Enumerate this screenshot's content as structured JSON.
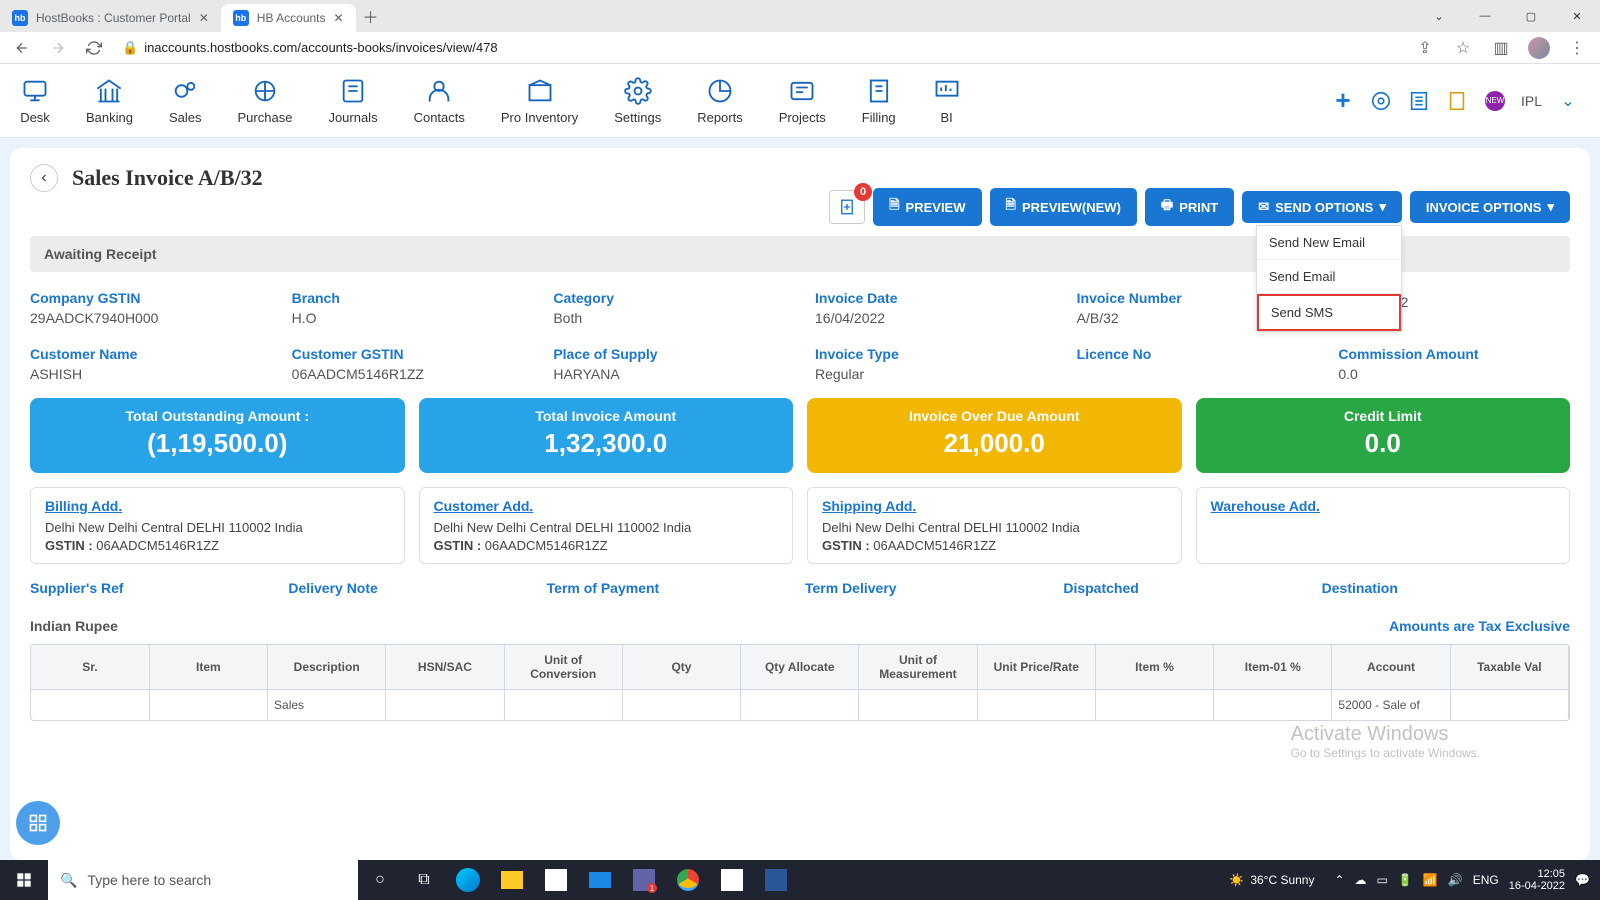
{
  "browser": {
    "tabs": [
      {
        "title": "HostBooks : Customer Portal",
        "favicon": "hb",
        "active": false
      },
      {
        "title": "HB Accounts",
        "favicon": "hb",
        "active": true
      }
    ],
    "url": "inaccounts.hostbooks.com/accounts-books/invoices/view/478"
  },
  "appnav": {
    "items": [
      "Desk",
      "Banking",
      "Sales",
      "Purchase",
      "Journals",
      "Contacts",
      "Pro Inventory",
      "Settings",
      "Reports",
      "Projects",
      "Filling",
      "BI"
    ],
    "company": "IPL"
  },
  "page_title": "Sales Invoice A/B/32",
  "buttons": {
    "preview": "PREVIEW",
    "preview_new": "PREVIEW(NEW)",
    "print": "PRINT",
    "send": "SEND OPTIONS",
    "invoice": "INVOICE OPTIONS",
    "badge": "0"
  },
  "send_menu": [
    "Send New Email",
    "Send Email",
    "Send SMS"
  ],
  "status": "Awaiting Receipt",
  "info": [
    {
      "l": "Company GSTIN",
      "v": "29AADCK7940H000"
    },
    {
      "l": "Branch",
      "v": "H.O"
    },
    {
      "l": "Category",
      "v": "Both"
    },
    {
      "l": "Invoice Date",
      "v": "16/04/2022"
    },
    {
      "l": "Invoice Number",
      "v": "A/B/32"
    },
    {
      "l": "",
      "v": "26/04/2022"
    },
    {
      "l": "Customer Name",
      "v": "ASHISH"
    },
    {
      "l": "Customer GSTIN",
      "v": "06AADCM5146R1ZZ"
    },
    {
      "l": "Place of Supply",
      "v": "HARYANA"
    },
    {
      "l": "Invoice Type",
      "v": "Regular"
    },
    {
      "l": "Licence No",
      "v": ""
    },
    {
      "l": "Commission Amount",
      "v": "0.0"
    }
  ],
  "summary": [
    {
      "t": "Total Outstanding Amount :",
      "v": "(1,19,500.0)",
      "c": "sb-blue"
    },
    {
      "t": "Total Invoice Amount",
      "v": "1,32,300.0",
      "c": "sb-blue"
    },
    {
      "t": "Invoice Over Due Amount",
      "v": "21,000.0",
      "c": "sb-yellow"
    },
    {
      "t": "Credit Limit",
      "v": "0.0",
      "c": "sb-green"
    }
  ],
  "addresses": [
    {
      "h": "Billing Add.",
      "ln": "Delhi New Delhi Central DELHI 110002 India",
      "g": "06AADCM5146R1ZZ"
    },
    {
      "h": "Customer Add.",
      "ln": "Delhi New Delhi Central DELHI 110002 India",
      "g": "06AADCM5146R1ZZ"
    },
    {
      "h": "Shipping Add.",
      "ln": "Delhi New Delhi Central DELHI 110002 India",
      "g": "06AADCM5146R1ZZ"
    },
    {
      "h": "Warehouse Add.",
      "ln": "",
      "g": ""
    }
  ],
  "misc": [
    "Supplier's Ref",
    "Delivery Note",
    "Term of Payment",
    "Term Delivery",
    "Dispatched",
    "Destination"
  ],
  "currency": "Indian Rupee",
  "tax_note": "Amounts are Tax Exclusive",
  "table": {
    "headers": [
      "Sr.",
      "Item",
      "Description",
      "HSN/SAC",
      "Unit of Conversion",
      "Qty",
      "Qty Allocate",
      "Unit of Measurement",
      "Unit Price/Rate",
      "Item %",
      "Item-01 %",
      "Account",
      "Taxable Val"
    ],
    "rows": [
      [
        "",
        "",
        "Sales",
        "",
        "",
        "",
        "",
        "",
        "",
        "",
        "",
        "52000 - Sale of",
        ""
      ]
    ]
  },
  "watermark": {
    "l1": "Activate Windows",
    "l2": "Go to Settings to activate Windows."
  },
  "taskbar": {
    "search_placeholder": "Type here to search",
    "weather": "36°C  Sunny",
    "lang": "ENG",
    "time": "12:05",
    "date": "16-04-2022"
  }
}
